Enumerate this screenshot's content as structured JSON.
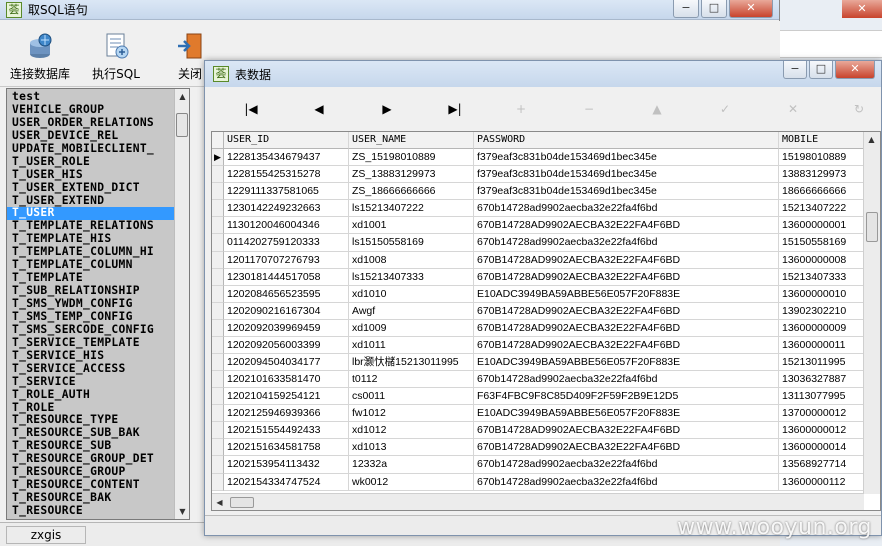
{
  "main_window": {
    "title": "取SQL语句",
    "toolbar": {
      "connect_label": "连接数据库",
      "execute_label": "执行SQL",
      "close_label": "关闭"
    },
    "tree_items": [
      "test",
      "VEHICLE_GROUP",
      "USER_ORDER_RELATIONS",
      "USER_DEVICE_REL",
      "UPDATE_MOBILECLIENT_",
      "T_USER_ROLE",
      "T_USER_HIS",
      "T_USER_EXTEND_DICT",
      "T_USER_EXTEND",
      "T_USER",
      "T_TEMPLATE_RELATIONS",
      "T_TEMPLATE_HIS",
      "T_TEMPLATE_COLUMN_HI",
      "T_TEMPLATE_COLUMN",
      "T_TEMPLATE",
      "T_SUB_RELATIONSHIP",
      "T_SMS_YWDM_CONFIG",
      "T_SMS_TEMP_CONFIG",
      "T_SMS_SERCODE_CONFIG",
      "T_SERVICE_TEMPLATE",
      "T_SERVICE_HIS",
      "T_SERVICE_ACCESS",
      "T_SERVICE",
      "T_ROLE_AUTH",
      "T_ROLE",
      "T_RESOURCE_TYPE",
      "T_RESOURCE_SUB_BAK",
      "T_RESOURCE_SUB",
      "T_RESOURCE_GROUP_DET",
      "T_RESOURCE_GROUP",
      "T_RESOURCE_CONTENT",
      "T_RESOURCE_BAK",
      "T_RESOURCE"
    ],
    "selected_tree_item": "T_USER",
    "status_text": "zxgis"
  },
  "data_window": {
    "title": "表数据",
    "nav": {
      "first": "|◀",
      "prev": "◀",
      "next": "▶",
      "last": "▶|",
      "insert": "+",
      "delete": "−",
      "edit": "▲",
      "post": "✓",
      "cancel": "✕",
      "refresh": "↻"
    },
    "columns": [
      "USER_ID",
      "USER_NAME",
      "PASSWORD",
      "MOBILE"
    ],
    "rows": [
      [
        "1228135434679437",
        "ZS_15198010889",
        "f379eaf3c831b04de153469d1bec345e",
        "15198010889"
      ],
      [
        "1228155425315278",
        "ZS_13883129973",
        "f379eaf3c831b04de153469d1bec345e",
        "13883129973"
      ],
      [
        "1229111337581065",
        "ZS_18666666666",
        "f379eaf3c831b04de153469d1bec345e",
        "18666666666"
      ],
      [
        "1230142249232663",
        "ls15213407222",
        "670b14728ad9902aecba32e22fa4f6bd",
        "15213407222"
      ],
      [
        "1130120046004346",
        "xd1001",
        "670B14728AD9902AECBA32E22FA4F6BD",
        "13600000001"
      ],
      [
        "0114202759120333",
        "ls15150558169",
        "670b14728ad9902aecba32e22fa4f6bd",
        "15150558169"
      ],
      [
        "1201170707276793",
        "xd1008",
        "670B14728AD9902AECBA32E22FA4F6BD",
        "13600000008"
      ],
      [
        "1230181444517058",
        "ls15213407333",
        "670B14728AD9902AECBA32E22FA4F6BD",
        "15213407333"
      ],
      [
        "1202084656523595",
        "xd1010",
        "E10ADC3949BA59ABBE56E057F20F883E",
        "13600000010"
      ],
      [
        "1202090216167304",
        "Awgf",
        "670B14728AD9902AECBA32E22FA4F6BD",
        "13902302210"
      ],
      [
        "1202092039969459",
        "xd1009",
        "670B14728AD9902AECBA32E22FA4F6BD",
        "13600000009"
      ],
      [
        "1202092056003399",
        "xd1011",
        "670B14728AD9902AECBA32E22FA4F6BD",
        "13600000011"
      ],
      [
        "1202094504034177",
        "lbr灏忕櫧15213011995",
        "E10ADC3949BA59ABBE56E057F20F883E",
        "15213011995"
      ],
      [
        "1202101633581470",
        "t0112",
        "670b14728ad9902aecba32e22fa4f6bd",
        "13036327887"
      ],
      [
        "1202104159254121",
        "cs0011",
        "F63F4FBC9F8C85D409F2F59F2B9E12D5",
        "13113077995"
      ],
      [
        "1202125946939366",
        "fw1012",
        "E10ADC3949BA59ABBE56E057F20F883E",
        "13700000012"
      ],
      [
        "1202151554492433",
        "xd1012",
        "670B14728AD9902AECBA32E22FA4F6BD",
        "13600000012"
      ],
      [
        "1202151634581758",
        "xd1013",
        "670B14728AD9902AECBA32E22FA4F6BD",
        "13600000014"
      ],
      [
        "1202153954113432",
        "12332a",
        "670b14728ad9902aecba32e22fa4f6bd",
        "13568927714"
      ],
      [
        "1202154334747524",
        "wk0012",
        "670b14728ad9902aecba32e22fa4f6bd",
        "13600000112"
      ]
    ]
  },
  "watermark": "www.wooyun.org",
  "colors": {
    "selection": "#3399ff",
    "tree_bg": "#c8c8c8",
    "titlebar": "#c6d7ec"
  }
}
